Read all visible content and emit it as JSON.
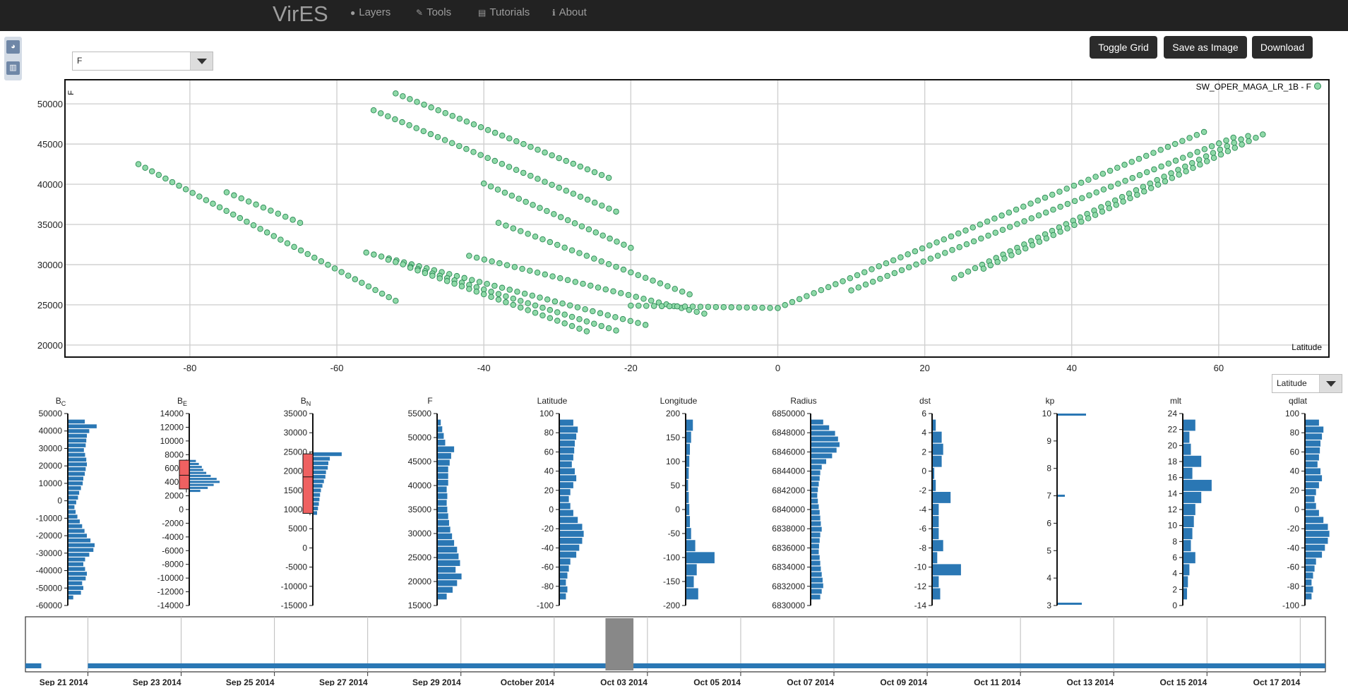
{
  "nav": {
    "brand": "VirES",
    "items": [
      {
        "label": "Layers",
        "icon": "globe-icon",
        "glyph": "●"
      },
      {
        "label": "Tools",
        "icon": "wrench-icon",
        "glyph": "✎"
      },
      {
        "label": "Tutorials",
        "icon": "book-icon",
        "glyph": "▤"
      },
      {
        "label": "About",
        "icon": "info-icon",
        "glyph": "ℹ"
      }
    ]
  },
  "side_tools": [
    {
      "icon": "globe-view-icon",
      "glyph": "◕"
    },
    {
      "icon": "analytics-view-icon",
      "glyph": "▥"
    }
  ],
  "yaxis_select": {
    "value": "F"
  },
  "xaxis_select": {
    "value": "Latitude"
  },
  "toolbar": {
    "toggle_grid": "Toggle Grid",
    "save_image": "Save as Image",
    "download": "Download"
  },
  "colors": {
    "point_fill": "#8fd9a8",
    "point_stroke": "#2c8a55",
    "bar": "#2a77b4",
    "box": "#ef6161",
    "navbar": "#222222"
  },
  "chart_data": [
    {
      "type": "scatter",
      "title": "",
      "ylabel": "F",
      "xlabel": "Latitude",
      "legend": "SW_OPER_MAGA_LR_1B - F",
      "legend_position": "top-right",
      "grid": true,
      "xlim": [
        -97,
        75
      ],
      "ylim": [
        18500,
        53000
      ],
      "xticks": [
        -80,
        -60,
        -40,
        -20,
        0,
        20,
        40,
        60
      ],
      "yticks": [
        20000,
        25000,
        30000,
        35000,
        40000,
        45000,
        50000
      ],
      "series": [
        {
          "segments": [
            {
              "x0": -87,
              "y0": 42500,
              "x1": -52,
              "y1": 25500
            },
            {
              "x0": -75,
              "y0": 39000,
              "x1": -65,
              "y1": 35200
            },
            {
              "x0": -52,
              "y0": 51300,
              "x1": -23,
              "y1": 40800
            },
            {
              "x0": -55,
              "y0": 49200,
              "x1": -22,
              "y1": 36600
            },
            {
              "x0": -40,
              "y0": 40100,
              "x1": -20,
              "y1": 32100
            },
            {
              "x0": -38,
              "y0": 35200,
              "x1": -12,
              "y1": 26300
            },
            {
              "x0": -42,
              "y0": 31100,
              "x1": -10,
              "y1": 23900
            },
            {
              "x0": -56,
              "y0": 31500,
              "x1": -18,
              "y1": 22500
            },
            {
              "x0": -53,
              "y0": 30600,
              "x1": -22,
              "y1": 21800
            },
            {
              "x0": -50,
              "y0": 29600,
              "x1": -26,
              "y1": 21700
            },
            {
              "x0": -20,
              "y0": 24900,
              "x1": 0,
              "y1": 24600
            },
            {
              "x0": 0,
              "y0": 24600,
              "x1": 58,
              "y1": 46500
            },
            {
              "x0": 10,
              "y0": 26800,
              "x1": 62,
              "y1": 45800
            },
            {
              "x0": 24,
              "y0": 28300,
              "x1": 64,
              "y1": 46000
            },
            {
              "x0": 28,
              "y0": 29500,
              "x1": 66,
              "y1": 46200
            }
          ]
        }
      ]
    },
    {
      "type": "bar",
      "orientation": "horizontal-histogram",
      "panels": [
        {
          "label": "B",
          "sub": "C",
          "yticks": [
            "50000",
            "40000",
            "30000",
            "20000",
            "10000",
            "0",
            "-10000",
            "-20000",
            "-30000",
            "-40000",
            "-50000",
            "-60000"
          ],
          "range": [
            -60000,
            50000
          ],
          "bins": [
            0.55,
            0.95,
            0.7,
            0.62,
            0.6,
            0.58,
            0.52,
            0.56,
            0.6,
            0.62,
            0.58,
            0.55,
            0.5,
            0.48,
            0.42,
            0.36,
            0.32,
            0.26,
            0.2,
            0.24,
            0.3,
            0.38,
            0.46,
            0.54,
            0.62,
            0.74,
            0.88,
            0.84,
            0.7,
            0.56,
            0.5,
            0.56,
            0.62,
            0.58,
            0.46,
            0.5,
            0.42,
            0.16
          ]
        },
        {
          "label": "B",
          "sub": "E",
          "yticks": [
            "14000",
            "12000",
            "10000",
            "8000",
            "6000",
            "4000",
            "2000",
            "0",
            "-2000",
            "-4000",
            "-6000",
            "-8000",
            "-10000",
            "-12000",
            "-14000"
          ],
          "range": [
            -14000,
            14000
          ],
          "box": {
            "q1": 3000,
            "q3": 7200,
            "median": 5000,
            "min": 2500,
            "max": 7300
          },
          "bins": [
            0.2,
            0.3,
            0.4,
            0.45,
            0.55,
            0.7,
            0.9,
            1.0,
            0.8,
            0.6,
            0.35
          ]
        },
        {
          "label": "B",
          "sub": "N",
          "yticks": [
            "35000",
            "30000",
            "25000",
            "20000",
            "15000",
            "10000",
            "5000",
            "0",
            "-5000",
            "-10000",
            "-15000"
          ],
          "range": [
            -15000,
            35000
          ],
          "box": {
            "q1": 9000,
            "q3": 24500,
            "median": 18500,
            "min": 8500,
            "max": 25000
          },
          "bins": [
            0.95,
            0.55,
            0.5,
            0.48,
            0.42,
            0.4,
            0.35,
            0.3,
            0.25,
            0.22,
            0.2,
            0.18,
            0.15,
            0.12
          ]
        },
        {
          "label": "F",
          "sub": "",
          "yticks": [
            "55000",
            "50000",
            "45000",
            "40000",
            "35000",
            "30000",
            "25000",
            "20000",
            "15000"
          ],
          "range": [
            15000,
            55000
          ],
          "bins": [
            0.1,
            0.15,
            0.2,
            0.25,
            0.55,
            0.45,
            0.4,
            0.35,
            0.35,
            0.35,
            0.3,
            0.32,
            0.3,
            0.32,
            0.35,
            0.38,
            0.42,
            0.48,
            0.55,
            0.65,
            0.7,
            0.75,
            0.6,
            0.8,
            0.65,
            0.5,
            0.3
          ]
        },
        {
          "label": "Latitude",
          "sub": "",
          "yticks": [
            "100",
            "80",
            "60",
            "40",
            "20",
            "0",
            "-20",
            "-40",
            "-60",
            "-80",
            "-100"
          ],
          "range": [
            -100,
            100
          ],
          "bins": [
            0.45,
            0.6,
            0.55,
            0.5,
            0.48,
            0.45,
            0.4,
            0.5,
            0.55,
            0.45,
            0.35,
            0.3,
            0.35,
            0.45,
            0.6,
            0.75,
            0.8,
            0.75,
            0.65,
            0.55,
            0.35,
            0.3,
            0.25,
            0.2,
            0.25,
            0.2
          ]
        },
        {
          "label": "Longitude",
          "sub": "",
          "yticks": [
            "200",
            "150",
            "100",
            "50",
            "0",
            "-50",
            "-100",
            "-150",
            "-200"
          ],
          "range": [
            -200,
            200
          ],
          "bins": [
            0.22,
            0.16,
            0.12,
            0.1,
            0.08,
            0.06,
            0.08,
            0.1,
            0.12,
            0.16,
            0.3,
            0.95,
            0.35,
            0.25,
            0.4
          ]
        },
        {
          "label": "Radius",
          "sub": "",
          "yticks": [
            "6850000",
            "6848000",
            "6846000",
            "6844000",
            "6842000",
            "6840000",
            "6838000",
            "6836000",
            "6834000",
            "6832000",
            "6830000"
          ],
          "range": [
            6830000,
            6850000
          ],
          "bins": [
            0.4,
            0.6,
            0.8,
            0.9,
            0.95,
            0.85,
            0.7,
            0.5,
            0.35,
            0.3,
            0.28,
            0.25,
            0.22,
            0.2,
            0.22,
            0.25,
            0.28,
            0.3,
            0.32,
            0.35,
            0.3,
            0.28,
            0.26,
            0.25,
            0.28,
            0.3,
            0.32,
            0.35,
            0.38,
            0.4,
            0.35,
            0.3
          ]
        },
        {
          "label": "dst",
          "sub": "",
          "yticks": [
            "6",
            "4",
            "2",
            "0",
            "-2",
            "-4",
            "-6",
            "-8",
            "-10",
            "-12",
            "-14"
          ],
          "range": [
            -14,
            6
          ],
          "bins": [
            0.1,
            0.3,
            0.35,
            0.3,
            0.05,
            0.1,
            0.6,
            0.2,
            0.2,
            0.2,
            0.35,
            0.15,
            0.95,
            0.2,
            0.25
          ]
        },
        {
          "label": "kp",
          "sub": "",
          "yticks": [
            "10",
            "9",
            "8",
            "7",
            "6",
            "5",
            "4",
            "3"
          ],
          "range": [
            3,
            10
          ],
          "bins": [
            1.0,
            0.25,
            0.85
          ]
        },
        {
          "label": "mlt",
          "sub": "",
          "yticks": [
            "24",
            "22",
            "20",
            "18",
            "16",
            "14",
            "12",
            "10",
            "8",
            "6",
            "4",
            "2",
            "0"
          ],
          "range": [
            0,
            24
          ],
          "bins": [
            0.4,
            0.2,
            0.25,
            0.6,
            0.3,
            0.95,
            0.6,
            0.4,
            0.35,
            0.3,
            0.25,
            0.4,
            0.2,
            0.15,
            0.12
          ]
        },
        {
          "label": "qdlat",
          "sub": "",
          "yticks": [
            "100",
            "80",
            "60",
            "40",
            "20",
            "0",
            "-20",
            "-40",
            "-60",
            "-80",
            "-100"
          ],
          "range": [
            -100,
            100
          ],
          "bins": [
            0.45,
            0.6,
            0.55,
            0.5,
            0.48,
            0.45,
            0.4,
            0.5,
            0.55,
            0.45,
            0.35,
            0.3,
            0.35,
            0.45,
            0.6,
            0.75,
            0.8,
            0.75,
            0.65,
            0.55,
            0.35,
            0.3,
            0.25,
            0.2,
            0.25,
            0.2
          ]
        }
      ]
    },
    {
      "type": "area",
      "name": "timeline",
      "tick_labels": [
        "Sep 21 2014",
        "Sep 23 2014",
        "Sep 25 2014",
        "Sep 27 2014",
        "Sep 29 2014",
        "October 2014",
        "Oct 03 2014",
        "Oct 05 2014",
        "Oct 07 2014",
        "Oct 09 2014",
        "Oct 11 2014",
        "Oct 13 2014",
        "Oct 15 2014",
        "Oct 17 2014"
      ],
      "start_day": 19.66,
      "end_day": 47.54,
      "selection": [
        32.1,
        32.7
      ],
      "coverage": [
        [
          19.66,
          20.0
        ],
        [
          21.0,
          31.0
        ],
        [
          31.0,
          47.54
        ]
      ]
    }
  ]
}
